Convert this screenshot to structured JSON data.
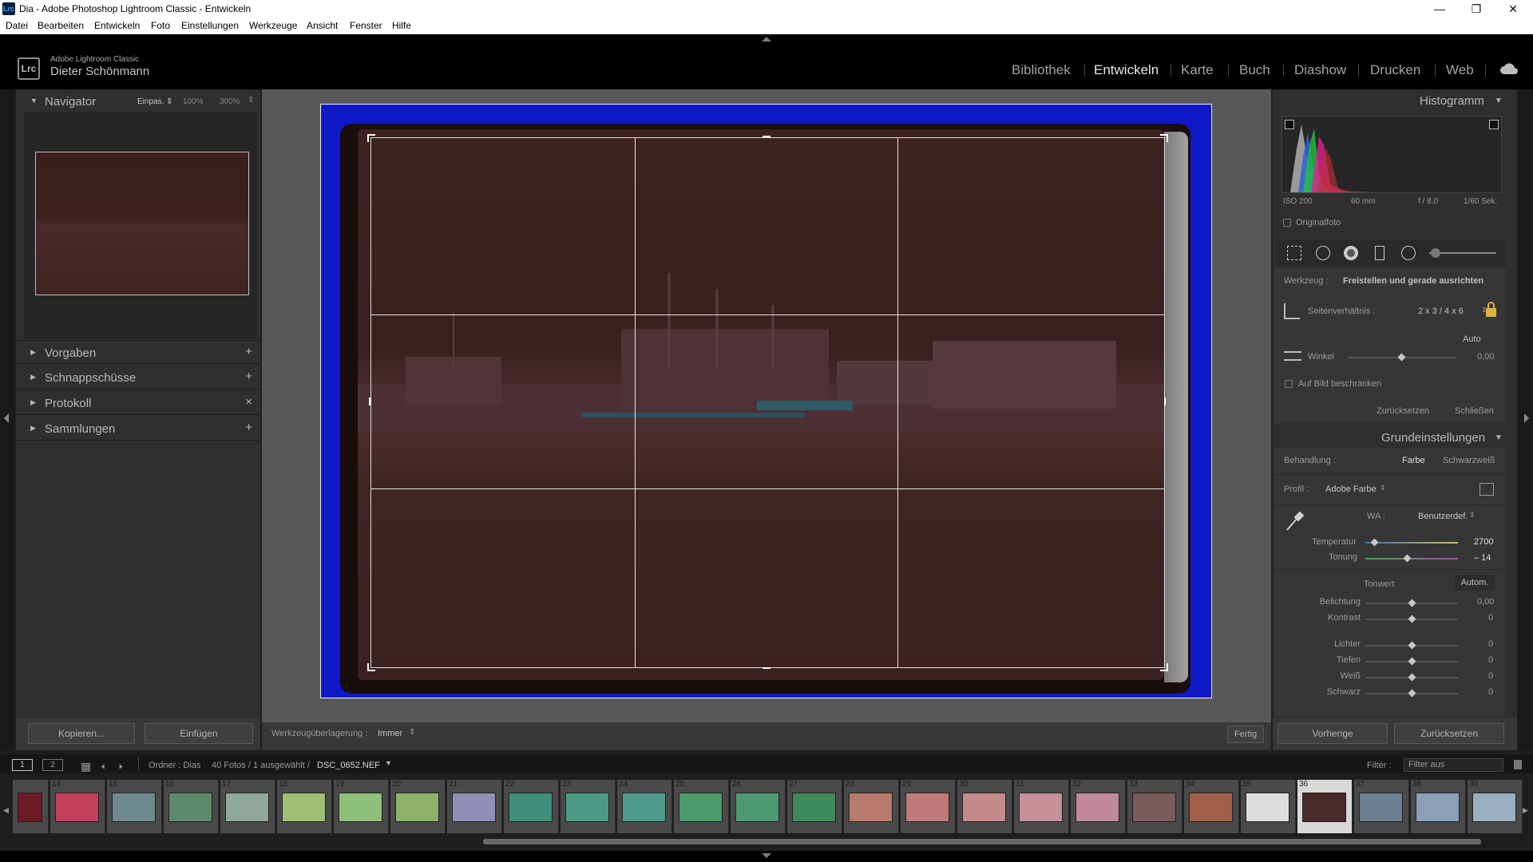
{
  "window": {
    "title": "Dia - Adobe Photoshop Lightroom Classic - Entwickeln",
    "icon_label": "Lrc",
    "controls": [
      "minimize-icon",
      "maximize-icon",
      "close-icon"
    ]
  },
  "menu": [
    "Datei",
    "Bearbeiten",
    "Entwickeln",
    "Foto",
    "Einstellungen",
    "Werkzeuge",
    "Ansicht",
    "Fenster",
    "Hilfe"
  ],
  "identity": {
    "logo": "Lrc",
    "product": "Adobe Lightroom Classic",
    "user": "Dieter Schönmann"
  },
  "modules": [
    "Bibliothek",
    "Entwickeln",
    "Karte",
    "Buch",
    "Diashow",
    "Drucken",
    "Web"
  ],
  "active_module": "Entwickeln",
  "left_panel": {
    "navigator": {
      "title": "Navigator",
      "fit": "Einpas. ⇕",
      "zoom1": "100%",
      "zoom2": "300%"
    },
    "sections": [
      {
        "label": "Vorgaben",
        "action": "+"
      },
      {
        "label": "Schnappschüsse",
        "action": "+"
      },
      {
        "label": "Protokoll",
        "action": "×"
      },
      {
        "label": "Sammlungen",
        "action": "+"
      }
    ],
    "copy_button": "Kopieren...",
    "paste_button": "Einfügen"
  },
  "toolbar": {
    "overlay_label": "Werkzeugüberlagerung :",
    "overlay_value": "Immer",
    "done_button": "Fertig"
  },
  "right_panel": {
    "histogram": {
      "title": "Histogramm",
      "iso": "ISO 200",
      "focal": "60 mm",
      "aperture": "f / 8,0",
      "shutter": "1/60 Sek.",
      "original": "Originalfoto"
    },
    "crop": {
      "tool_label": "Werkzeug :",
      "tool_value": "Freistellen und gerade ausrichten",
      "aspect_label": "Seitenverhältnis :",
      "aspect_value": "2 x 3 / 4 x 6",
      "auto": "Auto",
      "angle_label": "Winkel",
      "angle_value": "0,00",
      "angle_level": 0.5,
      "constrain": "Auf Bild beschränken",
      "reset": "Zurücksetzen",
      "close": "Schließen"
    },
    "basic": {
      "title": "Grundeinstellungen",
      "treatment_label": "Behandlung :",
      "color": "Farbe",
      "bw": "Schwarzweiß",
      "profile_label": "Profil :",
      "profile_value": "Adobe Farbe",
      "wb_label": "WA :",
      "wb_value": "Benutzerdef.",
      "temp_label": "Temperatur",
      "temp_value": "2700",
      "temp_level": 0.1,
      "tint_label": "Tonung",
      "tint_value": "– 14",
      "tint_level": 0.46,
      "tone_label": "Tonwert",
      "auto_tone": "Autom.",
      "sliders": [
        {
          "label": "Belichtung",
          "value": "0,00"
        },
        {
          "label": "Kontrast",
          "value": "0"
        },
        {
          "label": "Lichter",
          "value": "0"
        },
        {
          "label": "Tiefen",
          "value": "0"
        },
        {
          "label": "Weiß",
          "value": "0"
        },
        {
          "label": "Schwarz",
          "value": "0"
        }
      ]
    },
    "prev_button": "Vorherige",
    "reset_button": "Zurücksetzen"
  },
  "filmbar": {
    "screen1": "1",
    "screen2": "2",
    "source": "Ordner : Dias",
    "count": "40 Fotos / 1 ausgewählt /",
    "file": "DSC_0652.NEF",
    "filter_label": "Filter :",
    "filter_value": "Filter aus"
  },
  "filmstrip": [
    {
      "n": "",
      "c": "#6e1a24"
    },
    {
      "n": "14",
      "c": "#c2405a"
    },
    {
      "n": "15",
      "c": "#6f8a8f"
    },
    {
      "n": "16",
      "c": "#5d8a6a"
    },
    {
      "n": "17",
      "c": "#8fa89a"
    },
    {
      "n": "18",
      "c": "#9fbf74"
    },
    {
      "n": "19",
      "c": "#8fc07a"
    },
    {
      "n": "20",
      "c": "#8db36a"
    },
    {
      "n": "21",
      "c": "#8f8fb5"
    },
    {
      "n": "22",
      "c": "#3f8f7a"
    },
    {
      "n": "23",
      "c": "#4b9a84"
    },
    {
      "n": "24",
      "c": "#4f9b8b"
    },
    {
      "n": "25",
      "c": "#4a9a6a"
    },
    {
      "n": "26",
      "c": "#4d9a72"
    },
    {
      "n": "27",
      "c": "#3f8a5a"
    },
    {
      "n": "28",
      "c": "#b87a6a"
    },
    {
      "n": "29",
      "c": "#c07a78"
    },
    {
      "n": "30",
      "c": "#c48a8a"
    },
    {
      "n": "31",
      "c": "#c8909a"
    },
    {
      "n": "32",
      "c": "#c0889a"
    },
    {
      "n": "33",
      "c": "#7a5a5a"
    },
    {
      "n": "34",
      "c": "#a0604a"
    },
    {
      "n": "35",
      "c": "#dddddd"
    },
    {
      "n": "36",
      "c": "#4a2a2a"
    },
    {
      "n": "37",
      "c": "#6a7f90"
    },
    {
      "n": "38",
      "c": "#8aa0b8"
    },
    {
      "n": "39",
      "c": "#9ab0c0"
    }
  ],
  "selected_index": 23
}
